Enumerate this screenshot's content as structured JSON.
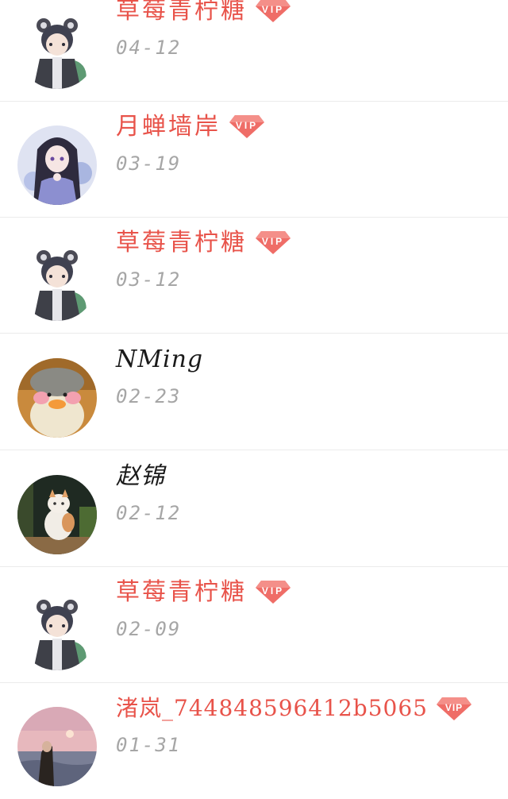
{
  "comments": [
    {
      "name": "草莓青柠糖",
      "vip": true,
      "date": "04-12",
      "avatar": "anime-boy-avatar"
    },
    {
      "name": "月蝉墙岸",
      "vip": true,
      "date": "03-19",
      "avatar": "anime-girl-avatar"
    },
    {
      "name": "草莓青柠糖",
      "vip": true,
      "date": "03-12",
      "avatar": "anime-boy-avatar"
    },
    {
      "name": "NMing",
      "vip": false,
      "date": "02-23",
      "avatar": "duck-plush-avatar"
    },
    {
      "name": "赵锦",
      "vip": false,
      "date": "02-12",
      "avatar": "cat-window-avatar"
    },
    {
      "name": "草莓青柠糖",
      "vip": true,
      "date": "02-09",
      "avatar": "anime-boy-avatar"
    },
    {
      "name": "渚岚_744848596412b5065",
      "vip": true,
      "date": "01-31",
      "avatar": "sunset-sea-avatar"
    }
  ],
  "vip_badge": {
    "label": "VIP",
    "color": "#ef6d67"
  },
  "colors": {
    "vip_name": "#e8534a",
    "plain_name": "#1a1a1a",
    "date": "#a6a6a6",
    "divider": "#ebebeb"
  }
}
